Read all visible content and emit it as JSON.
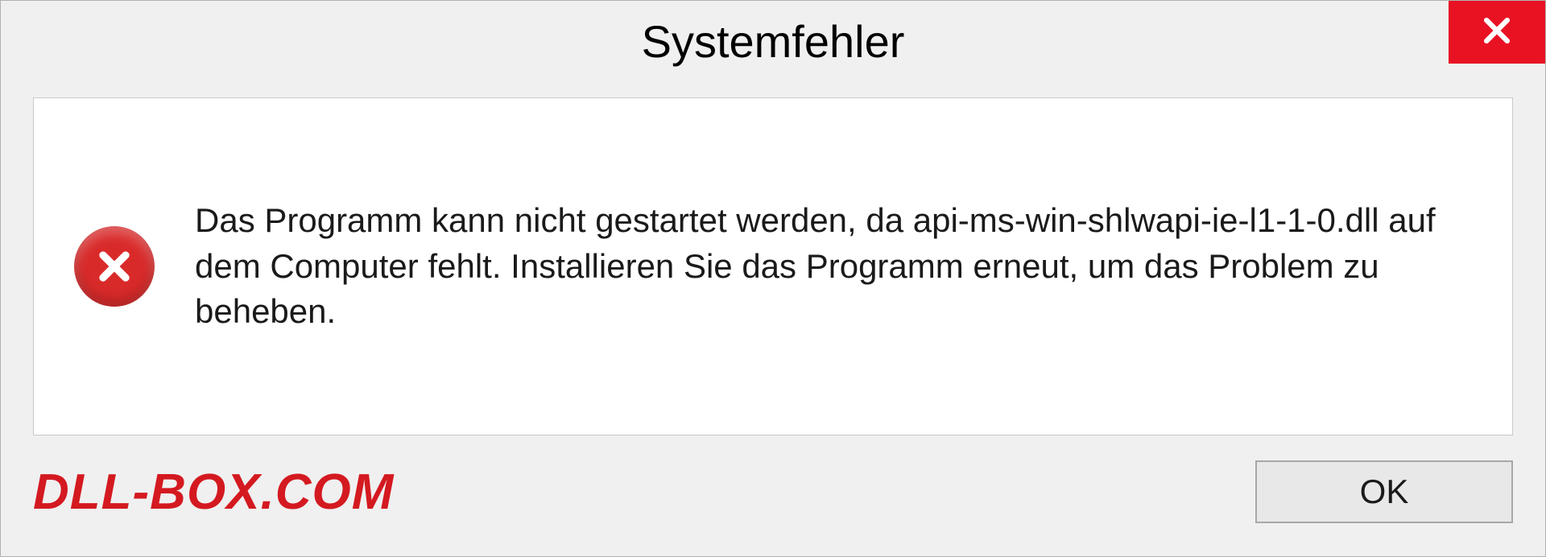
{
  "titlebar": {
    "title": "Systemfehler"
  },
  "content": {
    "message": "Das Programm kann nicht gestartet werden, da api-ms-win-shlwapi-ie-l1-1-0.dll auf dem Computer fehlt. Installieren Sie das Programm erneut, um das Problem zu beheben."
  },
  "footer": {
    "watermark": "DLL-BOX.COM",
    "ok_label": "OK"
  },
  "colors": {
    "close_button": "#e81223",
    "error_icon": "#d92a2a",
    "watermark": "#d41920"
  }
}
